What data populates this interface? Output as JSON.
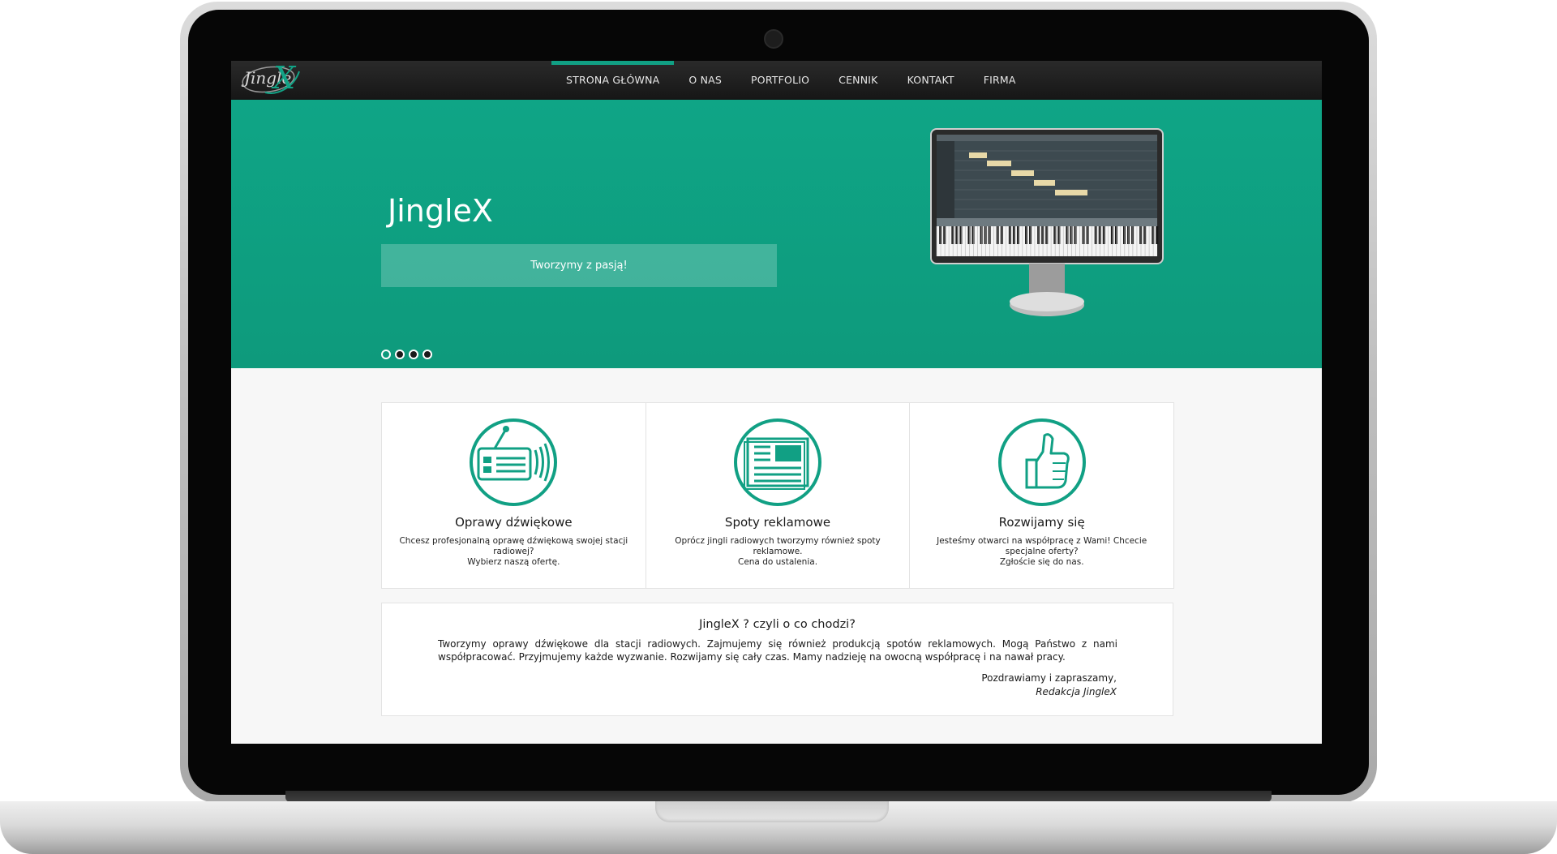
{
  "nav": {
    "logo_text": "Jingle",
    "logo_accent": "X",
    "items": [
      {
        "label": "STRONA GŁÓWNA",
        "active": true
      },
      {
        "label": "O NAS",
        "active": false
      },
      {
        "label": "PORTFOLIO",
        "active": false
      },
      {
        "label": "CENNIK",
        "active": false
      },
      {
        "label": "KONTAKT",
        "active": false
      },
      {
        "label": "FIRMA",
        "active": false
      }
    ]
  },
  "hero": {
    "title": "JingleX",
    "subtitle": "Tworzymy z pasją!",
    "slide_count": 4,
    "active_slide": 1
  },
  "features": [
    {
      "icon": "radio-icon",
      "title": "Oprawy dźwiękowe",
      "text": [
        "Chcesz profesjonalną oprawę dźwiękową swojej stacji radiowej?",
        "Wybierz naszą ofertę."
      ]
    },
    {
      "icon": "newspaper-icon",
      "title": "Spoty reklamowe",
      "text": [
        "Oprócz jingli radiowych tworzymy również spoty reklamowe.",
        "Cena do ustalenia."
      ]
    },
    {
      "icon": "thumbs-up-icon",
      "title": "Rozwijamy się",
      "text": [
        "Jesteśmy otwarci na współpracę z Wami! Chcecie specjalne oferty?",
        "Zgłoście się do nas."
      ]
    }
  ],
  "about": {
    "title": "JingleX ? czyli o co chodzi?",
    "text": "Tworzymy oprawy dźwiękowe dla stacji radiowych. Zajmujemy się również produkcją spotów reklamowych. Mogą Państwo z nami współpracować. Przyjmujemy każde wyzwanie. Rozwijamy się cały czas. Mamy nadzieję na owocną współpracę i na nawał pracy.",
    "greeting": "Pozdrawiamy i zapraszamy,",
    "signature": "Redakcja JingleX"
  },
  "colors": {
    "accent": "#11a084",
    "navbar": "#1e1e1e"
  }
}
